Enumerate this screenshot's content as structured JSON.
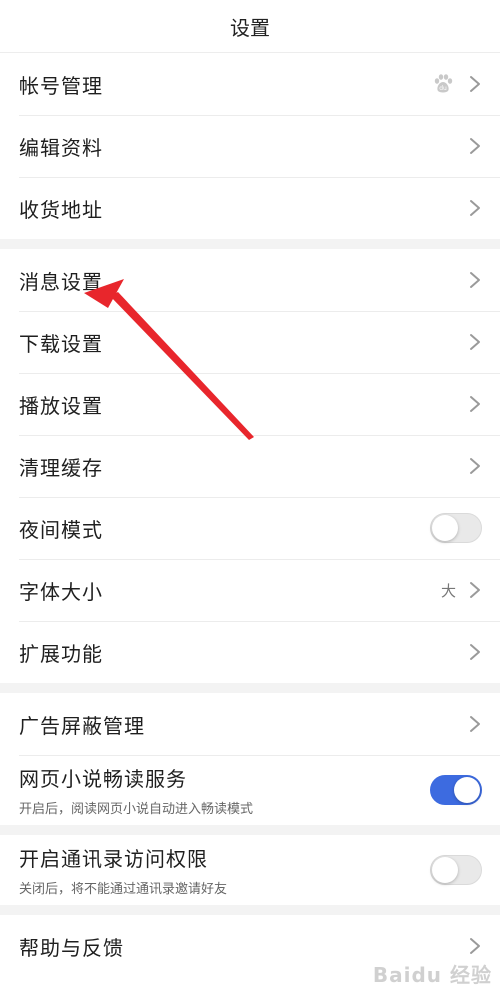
{
  "header": {
    "title": "设置"
  },
  "groups": [
    {
      "items": [
        {
          "label": "帐号管理",
          "right": "baidu-icon-chevron"
        },
        {
          "label": "编辑资料",
          "right": "chevron"
        },
        {
          "label": "收货地址",
          "right": "chevron"
        }
      ]
    },
    {
      "items": [
        {
          "label": "消息设置",
          "right": "chevron"
        },
        {
          "label": "下载设置",
          "right": "chevron"
        },
        {
          "label": "播放设置",
          "right": "chevron"
        },
        {
          "label": "清理缓存",
          "right": "chevron"
        },
        {
          "label": "夜间模式",
          "right": "toggle",
          "toggle_on": false
        },
        {
          "label": "字体大小",
          "right": "value-chevron",
          "value": "大"
        },
        {
          "label": "扩展功能",
          "right": "chevron"
        }
      ]
    },
    {
      "items": [
        {
          "label": "广告屏蔽管理",
          "right": "chevron"
        },
        {
          "label": "网页小说畅读服务",
          "desc": "开启后，阅读网页小说自动进入畅读模式",
          "right": "toggle",
          "toggle_on": true
        }
      ]
    },
    {
      "items": [
        {
          "label": "开启通讯录访问权限",
          "desc": "关闭后，将不能通过通讯录邀请好友",
          "right": "toggle",
          "toggle_on": false
        }
      ]
    },
    {
      "items": [
        {
          "label": "帮助与反馈",
          "right": "chevron"
        }
      ]
    }
  ],
  "colors": {
    "toggle_on": "#3d6be0",
    "annotation_arrow": "#e8262c",
    "divider": "#f3f3f3"
  },
  "watermark": "Baidu 经验"
}
